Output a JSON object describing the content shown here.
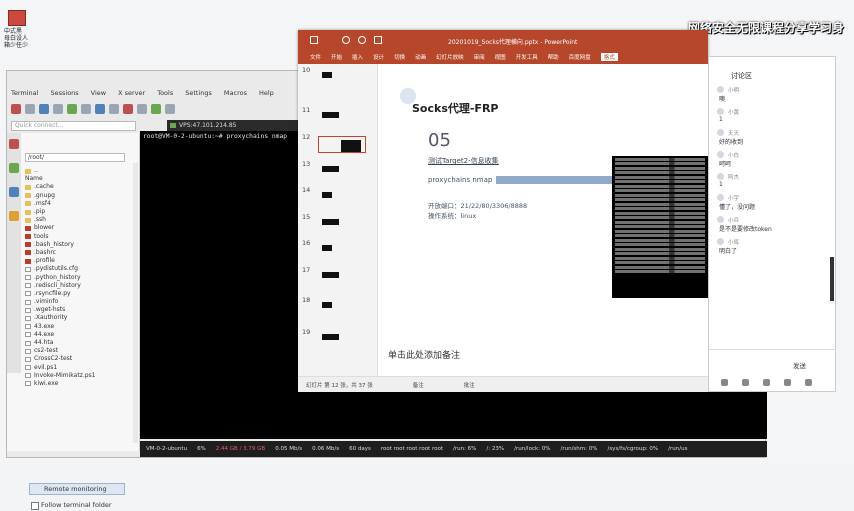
{
  "desktop": {
    "icon_label": "中式黑\n母白设人\n箱少任少",
    "overlay_title": "网络安全无限课程分享学习身"
  },
  "moba": {
    "menu": [
      "Terminal",
      "Sessions",
      "View",
      "X server",
      "Tools",
      "Settings",
      "Macros",
      "Help"
    ],
    "quick_connect_placeholder": "Quick connect...",
    "path": "/root/",
    "files": [
      {
        "name": "..",
        "type": "folder"
      },
      {
        "name": "Name",
        "type": "header"
      },
      {
        "name": ".cache",
        "type": "folder"
      },
      {
        "name": ".gnupg",
        "type": "folder"
      },
      {
        "name": ".msf4",
        "type": "folder"
      },
      {
        "name": ".pip",
        "type": "folder"
      },
      {
        "name": ".ssh",
        "type": "folder"
      },
      {
        "name": "blower",
        "type": "red"
      },
      {
        "name": "tools",
        "type": "red"
      },
      {
        "name": ".bash_history",
        "type": "red"
      },
      {
        "name": ".bashrc",
        "type": "red"
      },
      {
        "name": ".profile",
        "type": "red"
      },
      {
        "name": ".pydistutils.cfg",
        "type": "doc"
      },
      {
        "name": ".python_history",
        "type": "doc"
      },
      {
        "name": ".rediscli_history",
        "type": "doc"
      },
      {
        "name": ".rsyncfile.py",
        "type": "doc"
      },
      {
        "name": ".viminfo",
        "type": "doc"
      },
      {
        "name": ".wget-hsts",
        "type": "doc"
      },
      {
        "name": ".Xauthority",
        "type": "doc"
      },
      {
        "name": "43.exe",
        "type": "doc"
      },
      {
        "name": "44.exe",
        "type": "doc"
      },
      {
        "name": "44.hta",
        "type": "doc"
      },
      {
        "name": "cs2-test",
        "type": "doc"
      },
      {
        "name": "CrossC2-test",
        "type": "doc"
      },
      {
        "name": "evil.ps1",
        "type": "doc"
      },
      {
        "name": "Invoke-Mimikatz.ps1",
        "type": "doc"
      },
      {
        "name": "kiwi.exe",
        "type": "doc"
      }
    ],
    "remote_monitoring": "Remote monitoring",
    "follow_folder": "Follow terminal folder",
    "tab_label": "VPS:47.101.214.85",
    "prompt": "root@VM-0-2-ubuntu:~# proxychains nmap",
    "status": [
      "VM-0-2-ubuntu",
      "6%",
      "2.44 GB / 3.79 GB",
      "0.05 Mb/s",
      "0.06 Mb/s",
      "60 days",
      "root  root  root  root  root",
      "/run: 6%",
      "/: 23%",
      "/run/lock: 0%",
      "/run/shm: 0%",
      "/sys/fs/cgroup: 0%",
      "/run/us"
    ]
  },
  "ppt": {
    "doc_title": "20201019_Socks代理横向.pptx  -  PowerPoint",
    "ribbon": [
      "文件",
      "开始",
      "插入",
      "设计",
      "切换",
      "动画",
      "幻灯片放映",
      "审阅",
      "视图",
      "开发工具",
      "帮助",
      "百度网盘",
      "格式"
    ],
    "ribbon_selected": "格式",
    "thumbs": [
      "10",
      "11",
      "12",
      "13",
      "14",
      "15",
      "16",
      "17",
      "18",
      "19"
    ],
    "selected_thumb": "12",
    "slide": {
      "title": "Socks代理-FRP",
      "number": "05",
      "sub1": "测试Target2-信息收集",
      "sub2": "proxychains nmap",
      "sub3": "开放端口：21/22/80/3306/8888",
      "sub4": "操作系统：linux"
    },
    "notes_placeholder": "单击此处添加备注",
    "status_left": "幻灯片 第 12 张，共 37 张",
    "status_notes": "备注",
    "status_comments": "批注"
  },
  "chat": {
    "header": "讨论区",
    "messages": [
      {
        "who": "小明",
        "text": "噢"
      },
      {
        "who": "小黄",
        "text": "1"
      },
      {
        "who": "天天",
        "text": "好的收到"
      },
      {
        "who": "小白",
        "text": "呵呵"
      },
      {
        "who": "阿杰",
        "text": "1"
      },
      {
        "who": "小宇",
        "text": "懂了，没问题"
      },
      {
        "who": "小兵",
        "text": "是不是要修改token"
      },
      {
        "who": "小辉",
        "text": "明白了"
      }
    ],
    "send": "发送"
  }
}
